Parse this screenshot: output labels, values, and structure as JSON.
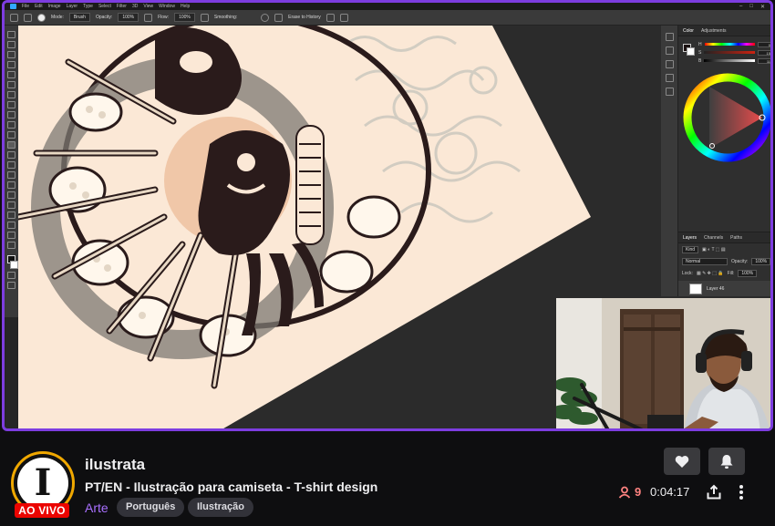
{
  "photoshop": {
    "menu": [
      "File",
      "Edit",
      "Image",
      "Layer",
      "Type",
      "Select",
      "Filter",
      "3D",
      "View",
      "Window",
      "Help"
    ],
    "options": {
      "mode_label": "Mode:",
      "mode_value": "Brush",
      "opacity_label": "Opacity:",
      "opacity_value": "100%",
      "flow_label": "Flow:",
      "flow_value": "100%",
      "smoothing_label": "Smoothing:",
      "erase_history_label": "Erase to History"
    },
    "color_panel": {
      "tabs": [
        "Color",
        "Adjustments"
      ],
      "slider_values": [
        "0",
        "15",
        "11"
      ]
    },
    "layers_panel": {
      "tabs": [
        "Layers",
        "Channels",
        "Paths"
      ],
      "kind_label": "Kind",
      "blend_mode": "Normal",
      "opacity_label": "Opacity:",
      "opacity_value": "100%",
      "lock_label": "Lock:",
      "fill_label": "Fill:",
      "fill_value": "100%",
      "layer_name": "Layer 46"
    }
  },
  "stream": {
    "channel_name": "ilustrata",
    "avatar_letter": "I",
    "live_label": "AO VIVO",
    "title": "PT/EN - Ilustração para camiseta - T-shirt design",
    "category": "Arte",
    "tags": [
      "Português",
      "Ilustração"
    ],
    "viewer_count": "9",
    "uptime": "0:04:17"
  },
  "icons": {
    "follow": "heart-icon",
    "notify": "bell-icon",
    "viewers": "person-icon",
    "share": "share-icon",
    "more": "more-vertical-icon"
  },
  "colors": {
    "accent": "#a970ff",
    "live_red": "#eb0400",
    "viewer_red": "#ff8280",
    "player_border": "#7d3de0",
    "avatar_ring": "#f0a800"
  }
}
